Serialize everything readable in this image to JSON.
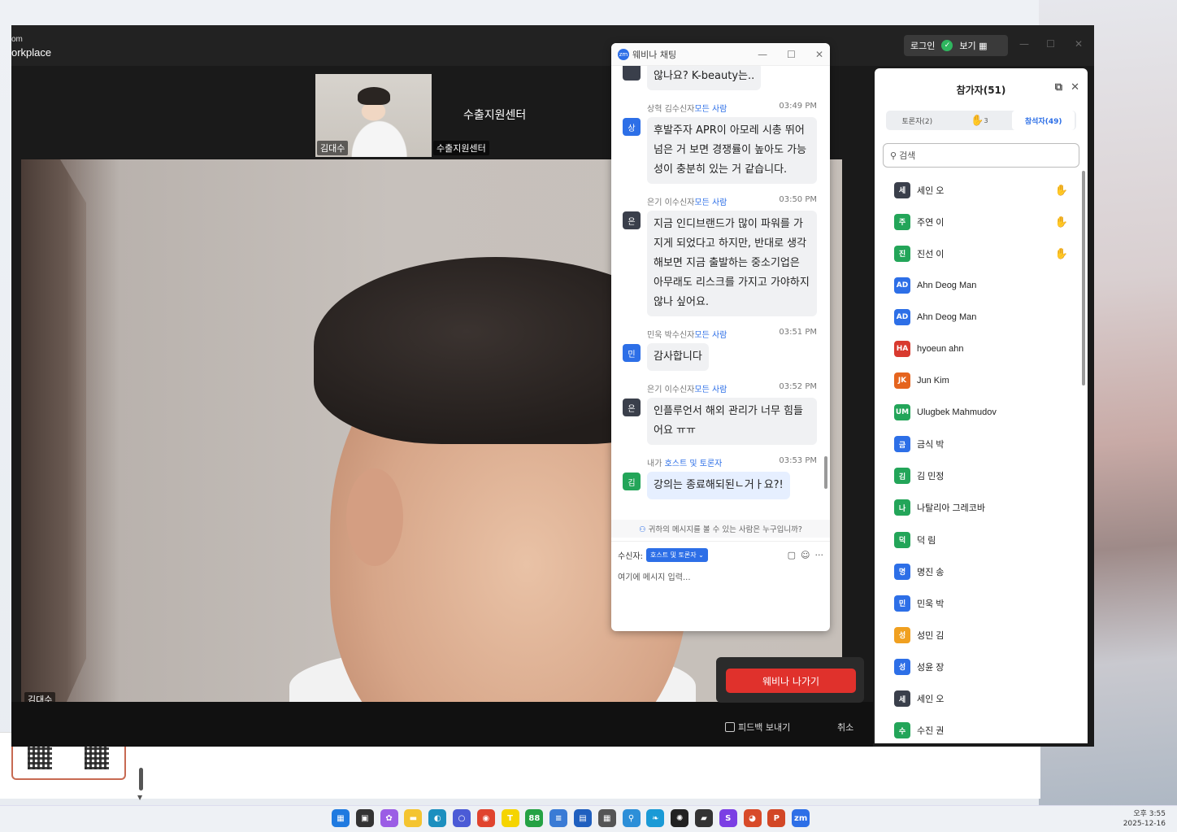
{
  "zoom": {
    "brand_top": "om",
    "brand": "orkplace",
    "login": "로그인",
    "view": "보기 ▦",
    "speaker_thumb_name": "김대수",
    "speaker_thumb_host": "수출지원센터",
    "speaker_label": "수출지원센터",
    "main_video_name": "김대수"
  },
  "chat": {
    "title": "웨비나 채팅",
    "partial_top": "않나요? K-beauty는..",
    "messages": [
      {
        "sender": "상혁 김수신자",
        "to": "모든 사람",
        "time": "03:49 PM",
        "avatar": "상",
        "text": "후발주자 APR이 아모레 시총 뛰어 넘은 거 보면 경쟁률이 높아도 가능성이 충분히 있는 거 같습니다."
      },
      {
        "sender": "은기 이수신자",
        "to": "모든 사람",
        "time": "03:50 PM",
        "avatar": "은",
        "text": "지금 인디브랜드가 많이 파워를 가지게 되었다고 하지만, 반대로 생각해보면 지금 출발하는 중소기업은 아무래도 리스크를 가지고 가야하지 않나 싶어요."
      },
      {
        "sender": "민욱 박수신자",
        "to": "모든 사람",
        "time": "03:51 PM",
        "avatar": "민",
        "text": "감사합니다"
      },
      {
        "sender": "은기 이수신자",
        "to": "모든 사람",
        "time": "03:52 PM",
        "avatar": "은",
        "text": "인플루언서 해외 관리가 너무 힘들어요 ㅠㅠ"
      },
      {
        "sender": "내가 ",
        "to": "호스트 및 토론자",
        "time": "03:53 PM",
        "avatar": "김",
        "text": "강의는 종료해되된ㄴ거ㅏ요?!"
      }
    ],
    "hint": "귀하의 메시지를 볼 수 있는 사람은 누구입니까?",
    "to_label": "수신자:",
    "to_value": "호스트 및 토론자 ⌄",
    "placeholder": "여기에 메시지 입력..."
  },
  "leave": {
    "button": "웨비나 나가기",
    "feedback": "피드백 보내기",
    "cancel": "취소"
  },
  "participants": {
    "title": "참가자(51)",
    "tab_panelists": "토론자(2)",
    "hands_count": "3",
    "tab_attendees": "참석자(49)",
    "search": "검색",
    "list": [
      {
        "av": "세",
        "name": "세인 오",
        "color": "#3a3f4b",
        "hand": true
      },
      {
        "av": "주",
        "name": "주연 이",
        "color": "#23a559",
        "hand": true
      },
      {
        "av": "진",
        "name": "진선 이",
        "color": "#23a559",
        "hand": true
      },
      {
        "av": "AD",
        "name": "Ahn Deog Man",
        "color": "#2d6fe7",
        "hand": false
      },
      {
        "av": "AD",
        "name": "Ahn Deog Man",
        "color": "#2d6fe7",
        "hand": false
      },
      {
        "av": "HA",
        "name": "hyoeun ahn",
        "color": "#d83a2f",
        "hand": false
      },
      {
        "av": "JK",
        "name": "Jun Kim",
        "color": "#e5641e",
        "hand": false
      },
      {
        "av": "UM",
        "name": "Ulugbek Mahmudov",
        "color": "#23a559",
        "hand": false
      },
      {
        "av": "금",
        "name": "금식 박",
        "color": "#2d6fe7",
        "hand": false
      },
      {
        "av": "김",
        "name": "김 민정",
        "color": "#23a559",
        "hand": false
      },
      {
        "av": "나",
        "name": "나탈리아 그레코바",
        "color": "#23a559",
        "hand": false
      },
      {
        "av": "덕",
        "name": "덕 림",
        "color": "#23a559",
        "hand": false
      },
      {
        "av": "명",
        "name": "명진 송",
        "color": "#2d6fe7",
        "hand": false
      },
      {
        "av": "민",
        "name": "민욱 박",
        "color": "#2d6fe7",
        "hand": false
      },
      {
        "av": "성",
        "name": "성민 김",
        "color": "#f0a020",
        "hand": false
      },
      {
        "av": "성",
        "name": "성윤 장",
        "color": "#2d6fe7",
        "hand": false
      },
      {
        "av": "세",
        "name": "세인 오",
        "color": "#3a3f4b",
        "hand": false
      },
      {
        "av": "수",
        "name": "수진 권",
        "color": "#23a559",
        "hand": false
      }
    ]
  },
  "taskbar": {
    "icons": [
      {
        "name": "windows-start-icon",
        "color": "#1f7ae0",
        "glyph": "▦"
      },
      {
        "name": "task-view-icon",
        "color": "#333",
        "glyph": "▣"
      },
      {
        "name": "copilot-icon",
        "color": "#9b5de5",
        "glyph": "✿"
      },
      {
        "name": "file-explorer-icon",
        "color": "#f4c430",
        "glyph": "▬"
      },
      {
        "name": "edge-icon",
        "color": "#1c8fbf",
        "glyph": "◐"
      },
      {
        "name": "app-circle-icon",
        "color": "#4b5bd6",
        "glyph": "○"
      },
      {
        "name": "chrome-icon",
        "color": "#e0442e",
        "glyph": "◉"
      },
      {
        "name": "kakaotalk-icon",
        "color": "#f5d400",
        "glyph": "T"
      },
      {
        "name": "whatsapp-icon",
        "color": "#25a244",
        "glyph": "88"
      },
      {
        "name": "notepad-icon",
        "color": "#3a7bd5",
        "glyph": "≡"
      },
      {
        "name": "store-icon",
        "color": "#1f5fbf",
        "glyph": "▤"
      },
      {
        "name": "calculator-icon",
        "color": "#555",
        "glyph": "▦"
      },
      {
        "name": "network-icon",
        "color": "#2d8fd8",
        "glyph": "⚲"
      },
      {
        "name": "app-leaf-icon",
        "color": "#1a9ad6",
        "glyph": "❧"
      },
      {
        "name": "chatgpt-icon",
        "color": "#222",
        "glyph": "✺"
      },
      {
        "name": "sticky-notes-icon",
        "color": "#333",
        "glyph": "▰"
      },
      {
        "name": "app-s-icon",
        "color": "#7b3fe4",
        "glyph": "S"
      },
      {
        "name": "chrome-profile-icon",
        "color": "#d84b2a",
        "glyph": "◕"
      },
      {
        "name": "powerpoint-icon",
        "color": "#d24726",
        "glyph": "P"
      },
      {
        "name": "zoom-icon",
        "color": "#2d6fe7",
        "glyph": "zm"
      }
    ],
    "time": "오후 3:55",
    "date": "2025-12-16"
  }
}
